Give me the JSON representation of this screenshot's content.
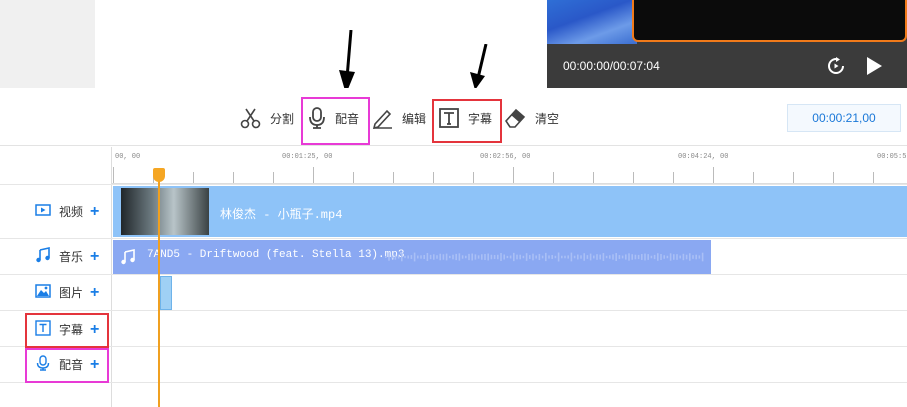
{
  "preview": {
    "time_display": "00:00:00/00:07:04",
    "replay_icon": "replay-icon",
    "play_icon": "play-icon"
  },
  "toolbar": {
    "split_label": "分割",
    "voiceover_label": "配音",
    "edit_label": "编辑",
    "subtitle_label": "字幕",
    "clear_label": "清空",
    "time_value": "00:00:21,00"
  },
  "ruler": {
    "ticks": [
      "00, 00",
      "00:01:25, 00",
      "00:02:56, 00",
      "00:04:24, 00",
      "00:05:5"
    ]
  },
  "tracks": [
    {
      "label": "视频",
      "icon": "video-icon"
    },
    {
      "label": "音乐",
      "icon": "music-icon"
    },
    {
      "label": "图片",
      "icon": "image-icon"
    },
    {
      "label": "字幕",
      "icon": "text-icon"
    },
    {
      "label": "配音",
      "icon": "microphone-icon"
    }
  ],
  "clips": {
    "video_clip_name": "林俊杰 - 小瓶子.mp4",
    "audio_clip_name": "7AND5 - Driftwood (feat. Stella 13).mp3"
  },
  "colors": {
    "accent_blue": "#1a7ee6",
    "video_clip": "#8ec3f8",
    "audio_clip": "#8aa8f2",
    "playhead": "#f0a020",
    "highlight_magenta": "#e83ad6",
    "highlight_red": "#e4343c"
  }
}
